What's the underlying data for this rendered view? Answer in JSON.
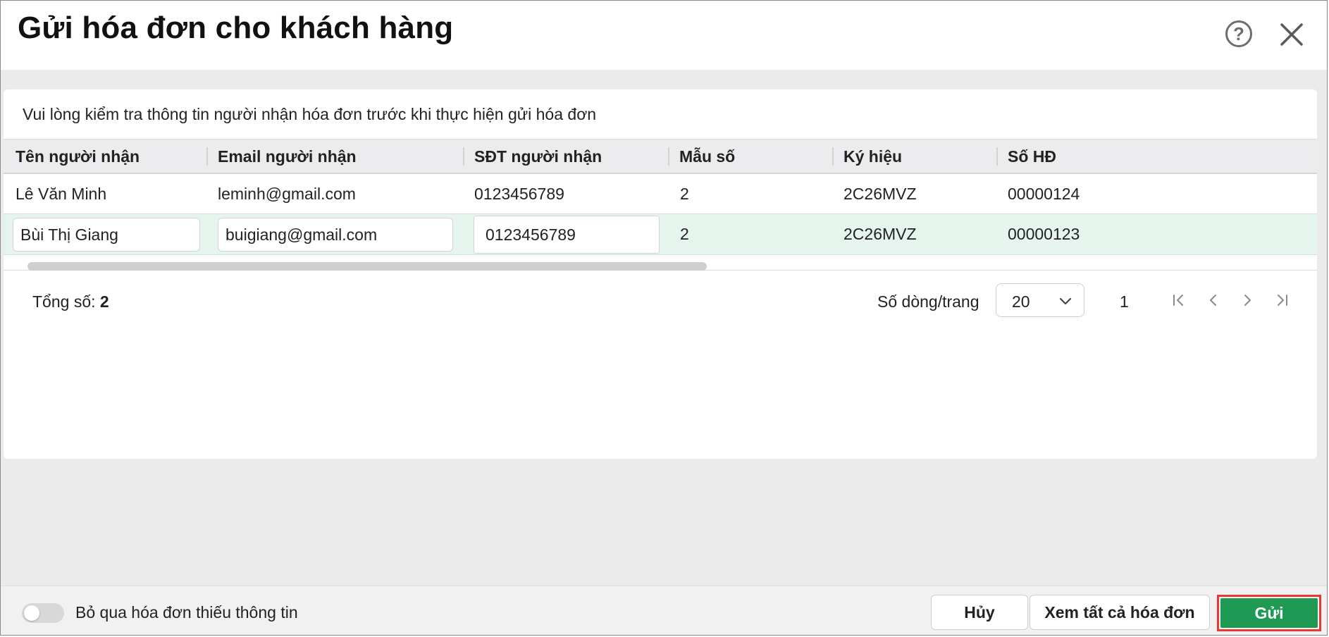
{
  "dialog": {
    "title": "Gửi hóa đơn cho khách hàng",
    "help_icon": "question-circle-icon",
    "close_icon": "close-icon"
  },
  "notice": "Vui lòng kiểm tra thông tin người nhận hóa đơn trước khi thực hiện gửi hóa đơn",
  "table": {
    "columns": [
      "Tên người nhận",
      "Email người nhận",
      "SĐT người nhận",
      "Mẫu số",
      "Ký hiệu",
      "Số HĐ"
    ],
    "rows": [
      {
        "name": "Lê Văn Minh",
        "email": "leminh@gmail.com",
        "phone": "0123456789",
        "template": "2",
        "symbol": "2C26MVZ",
        "number": "00000124"
      },
      {
        "name": "Bùi Thị Giang",
        "email": "buigiang@gmail.com",
        "phone": "0123456789",
        "template": "2",
        "symbol": "2C26MVZ",
        "number": "00000123"
      }
    ]
  },
  "pagination": {
    "total_label": "Tổng số:",
    "total_value": "2",
    "page_size_label": "Số dòng/trang",
    "page_size": "20",
    "current_page": "1"
  },
  "footer": {
    "skip_toggle_label": "Bỏ qua hóa đơn thiếu thông tin",
    "cancel_label": "Hủy",
    "view_all_label": "Xem tất cả hóa đơn",
    "send_label": "Gửi"
  },
  "colors": {
    "primary": "#1f9a55",
    "highlight_outline": "#e53935",
    "selected_row": "#e6f4ee"
  }
}
